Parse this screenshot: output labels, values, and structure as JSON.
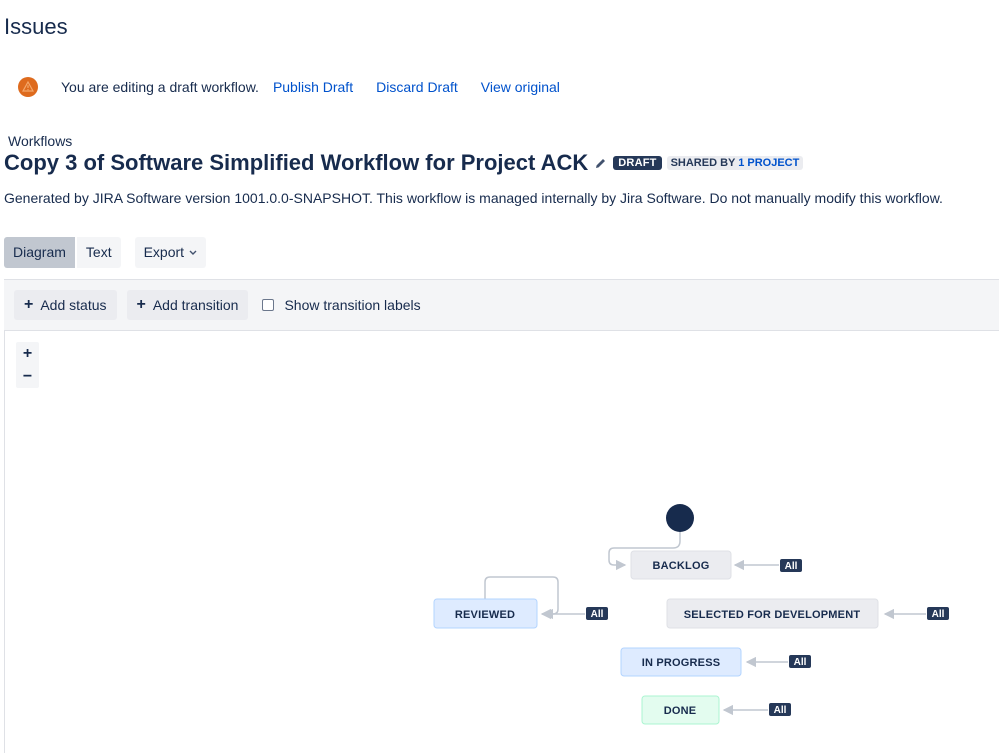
{
  "page": {
    "title": "Issues"
  },
  "draft_bar": {
    "message": "You are editing a draft workflow.",
    "publish": "Publish Draft",
    "discard": "Discard Draft",
    "view_original": "View original"
  },
  "breadcrumb": "Workflows",
  "workflow": {
    "title": "Copy 3 of Software Simplified Workflow for Project ACK",
    "draft_badge": "DRAFT",
    "shared_prefix": "SHARED BY",
    "shared_count": "1 PROJECT",
    "description": "Generated by JIRA Software version 1001.0.0-SNAPSHOT. This workflow is managed internally by Jira Software. Do not manually modify this workflow."
  },
  "view_tabs": [
    {
      "label": "Diagram",
      "active": true
    },
    {
      "label": "Text",
      "active": false
    }
  ],
  "export_label": "Export",
  "toolbar": {
    "add_status": "Add status",
    "add_transition": "Add transition",
    "show_labels": "Show transition labels",
    "show_labels_checked": false
  },
  "zoom": {
    "in": "+",
    "out": "−"
  },
  "statuses": [
    {
      "id": "backlog",
      "label": "BACKLOG",
      "category": "todo",
      "global_label": "All"
    },
    {
      "id": "reviewed",
      "label": "REVIEWED",
      "category": "inprogress",
      "global_label": "All"
    },
    {
      "id": "selected",
      "label": "SELECTED FOR DEVELOPMENT",
      "category": "todo",
      "global_label": "All"
    },
    {
      "id": "inprogress",
      "label": "IN PROGRESS",
      "category": "inprogress",
      "global_label": "All"
    },
    {
      "id": "done",
      "label": "DONE",
      "category": "done",
      "global_label": "All"
    }
  ],
  "colors": {
    "todo_fill": "#ebecf0",
    "todo_stroke": "#dfe1e6",
    "inprogress_fill": "#deebff",
    "inprogress_stroke": "#b3d4ff",
    "done_fill": "#e3fcef",
    "done_stroke": "#abf5d1",
    "all_badge": "#253858",
    "connector": "#c1c7d0",
    "initial_node": "#172b4d"
  },
  "icons": {
    "warning": "warning-icon",
    "edit": "pencil-icon",
    "export_chevron": "chevron-down-icon",
    "plus": "plus-icon"
  }
}
